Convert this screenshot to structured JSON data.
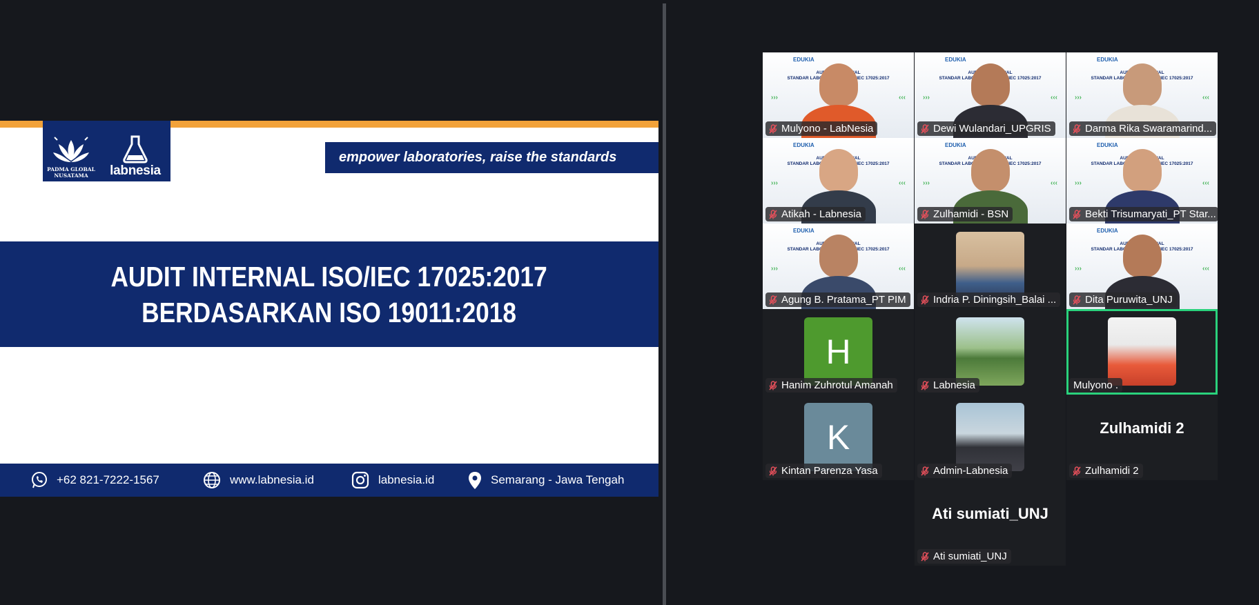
{
  "share": {
    "padma_label": "PADMA GLOBAL\nNUSATAMA",
    "brand_label": "labnesia",
    "tagline": "empower laboratories, raise the standards",
    "title_line1": "AUDIT INTERNAL ISO/IEC 17025:2017",
    "title_line2": "BERDASARKAN ISO 19011:2018",
    "contacts": {
      "phone": "+62 821-7222-1567",
      "website": "www.labnesia.id",
      "instagram": "labnesia.id",
      "location": "Semarang - Jawa Tengah"
    },
    "colors": {
      "navy": "#102a6e",
      "orange": "#f2a23a"
    }
  },
  "thumbnail": {
    "brand": "EDUKIA",
    "heading1": "AUDITOR INTERNAL",
    "heading2": "STANDAR LABORATORIUM ISO/IEC 17025:2017"
  },
  "participants": [
    {
      "name": "Mulyono - LabNesia",
      "muted": true,
      "type": "video"
    },
    {
      "name": "Dewi Wulandari_UPGRIS",
      "muted": true,
      "type": "video"
    },
    {
      "name": "Darma Rika Swaramarind...",
      "muted": true,
      "type": "video"
    },
    {
      "name": "Atikah - Labnesia",
      "muted": true,
      "type": "video"
    },
    {
      "name": "Zulhamidi - BSN",
      "muted": true,
      "type": "video"
    },
    {
      "name": "Bekti Trisumaryati_PT Star...",
      "muted": true,
      "type": "video"
    },
    {
      "name": "Agung B. Pratama_PT PIM",
      "muted": true,
      "type": "video"
    },
    {
      "name": "Indria P.  Diningsih_Balai ...",
      "muted": true,
      "type": "photo"
    },
    {
      "name": "Dita Puruwita_UNJ",
      "muted": true,
      "type": "video"
    },
    {
      "name": "Hanim Zuhrotul Amanah",
      "muted": true,
      "type": "initial",
      "initial": "H",
      "color": "#4e9a2e"
    },
    {
      "name": "Labnesia",
      "muted": true,
      "type": "photo"
    },
    {
      "name": "Mulyono .",
      "muted": false,
      "type": "photo",
      "speaking": true
    },
    {
      "name": "Kintan Parenza Yasa",
      "muted": true,
      "type": "initial",
      "initial": "K",
      "color": "#6a8a9a"
    },
    {
      "name": "Admin-Labnesia",
      "muted": true,
      "type": "photo"
    },
    {
      "name": "Zulhamidi 2",
      "muted": true,
      "type": "name-only",
      "display": "Zulhamidi 2"
    },
    {
      "name": "Ati sumiati_UNJ",
      "muted": true,
      "type": "name-only",
      "display": "Ati sumiati_UNJ"
    }
  ],
  "icons": {
    "muted_mic": "mic-muted-icon",
    "phone": "whatsapp-icon",
    "web": "globe-icon",
    "instagram": "instagram-icon",
    "location": "location-pin-icon"
  },
  "active_speaker_color": "#2ad27c"
}
